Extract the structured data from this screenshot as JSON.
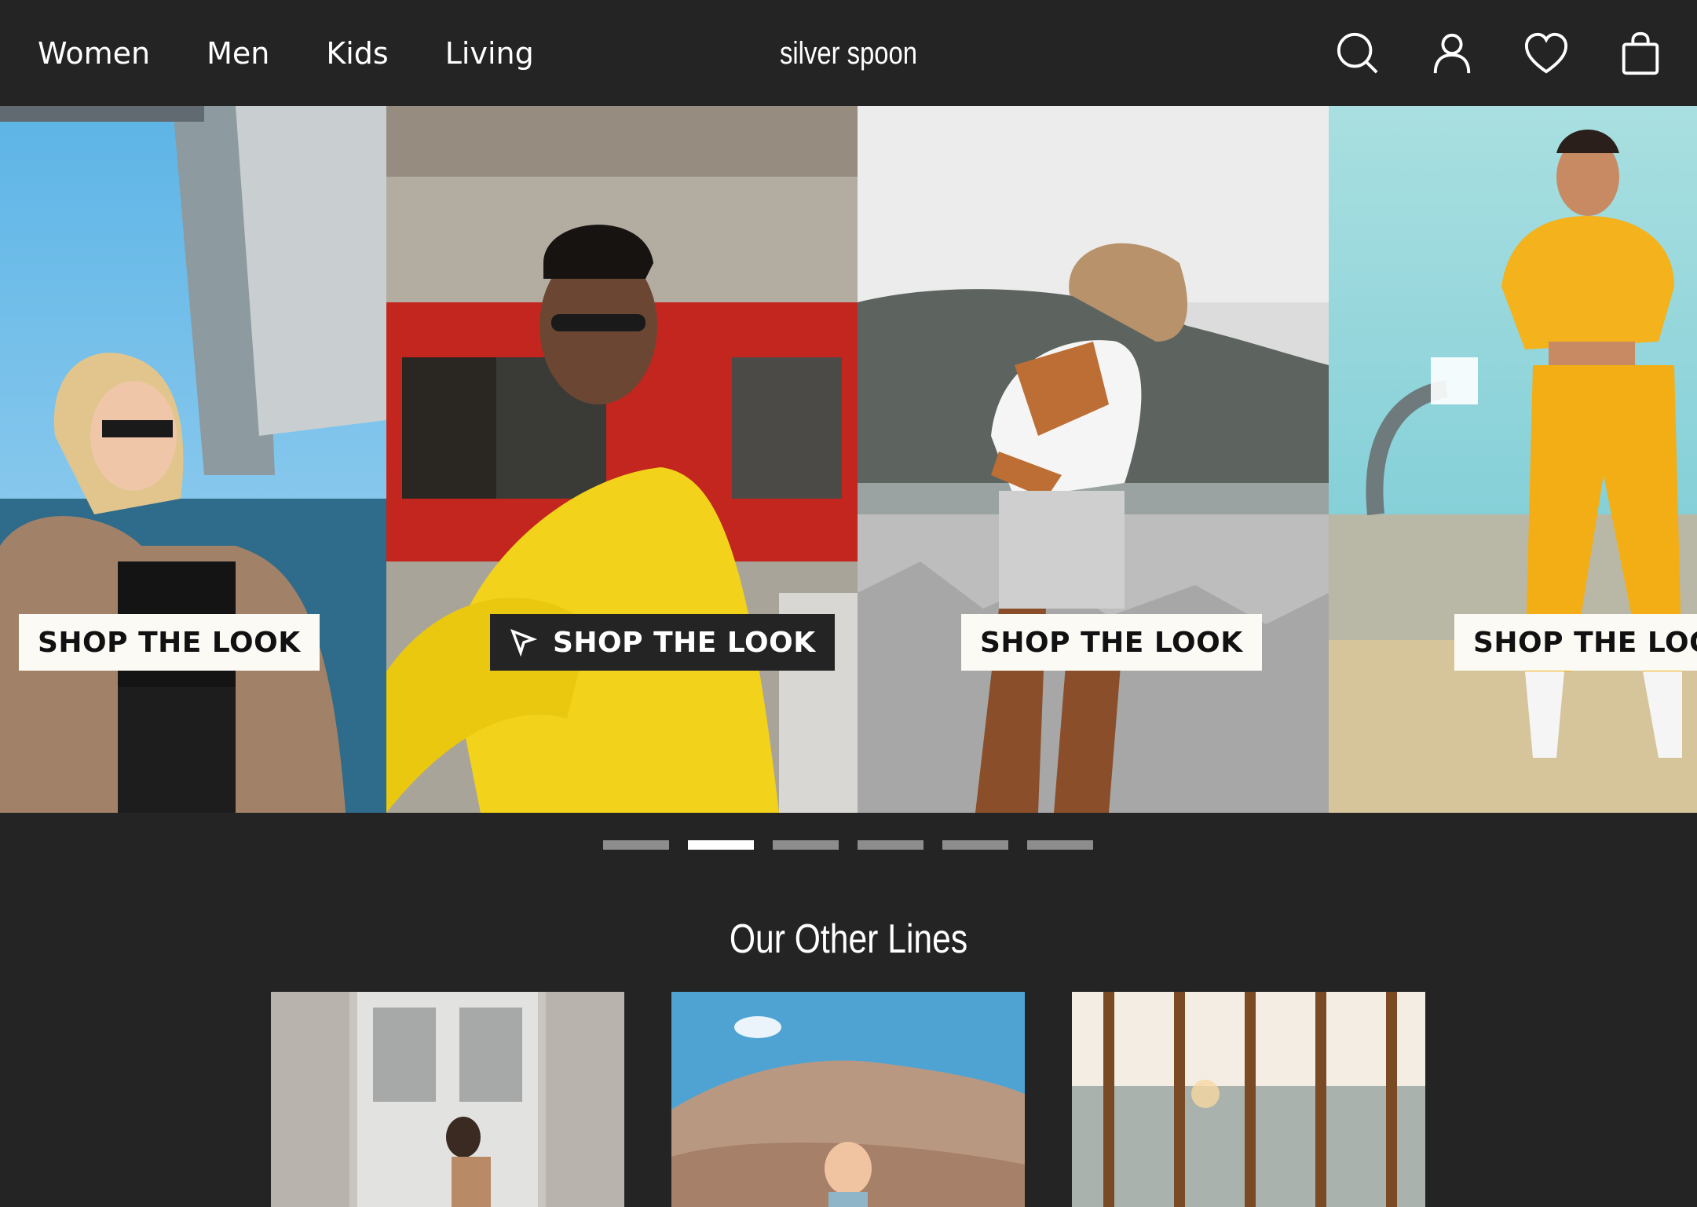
{
  "header": {
    "nav": [
      "Women",
      "Men",
      "Kids",
      "Living"
    ],
    "brand": "silver spoon",
    "icons": [
      "search-icon",
      "account-icon",
      "wishlist-heart-icon",
      "shopping-bag-icon"
    ]
  },
  "carousel": {
    "slides": [
      {
        "cta": "SHOP THE LOOK"
      },
      {
        "cta": "SHOP THE LOOK",
        "hovered": true
      },
      {
        "cta": "SHOP THE LOOK"
      },
      {
        "cta": "SHOP THE LOOK"
      }
    ],
    "pagination": {
      "count": 6,
      "active_index": 2
    }
  },
  "other_lines": {
    "title": "Our Other Lines"
  },
  "colors": {
    "background": "#242424",
    "cta_light": "#fbfaf5",
    "dot_inactive": "#8d8d8d",
    "dot_active": "#ffffff"
  }
}
